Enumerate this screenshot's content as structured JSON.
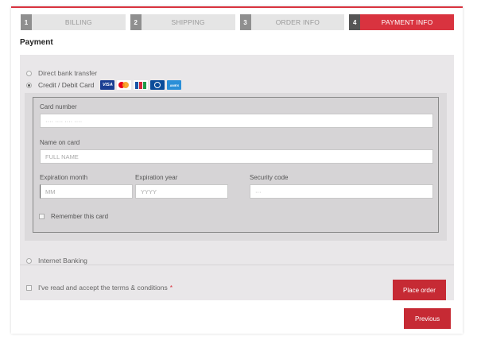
{
  "steps": [
    {
      "num": "1",
      "label": "BILLING"
    },
    {
      "num": "2",
      "label": "SHIPPING"
    },
    {
      "num": "3",
      "label": "ORDER INFO"
    },
    {
      "num": "4",
      "label": "PAYMENT INFO"
    }
  ],
  "active_step": 4,
  "title": "Payment",
  "methods": {
    "bank": "Direct bank transfer",
    "card": "Credit / Debit Card",
    "internet": "Internet Banking",
    "selected": "card"
  },
  "card_logos": [
    "visa-icon",
    "mastercard-icon",
    "jcb-icon",
    "diners-club-icon",
    "amex-icon"
  ],
  "card_logo_text": {
    "visa": "VISA",
    "amex": "AMEX"
  },
  "form": {
    "card_number_label": "Card number",
    "card_number_placeholder": "···· ···· ···· ····",
    "name_label": "Name on card",
    "name_placeholder": "FULL NAME",
    "exp_month_label": "Expiration month",
    "exp_month_placeholder": "MM",
    "exp_year_label": "Expiration year",
    "exp_year_placeholder": "YYYY",
    "security_label": "Security code",
    "security_placeholder": "···",
    "remember_label": "Remember this card"
  },
  "terms_label": "I've read and accept the terms & conditions",
  "terms_required_mark": "*",
  "buttons": {
    "place_order": "Place order",
    "previous": "Previous"
  },
  "colors": {
    "accent": "#d9333f",
    "button": "#c62a34",
    "panel": "#e9e7e9"
  }
}
